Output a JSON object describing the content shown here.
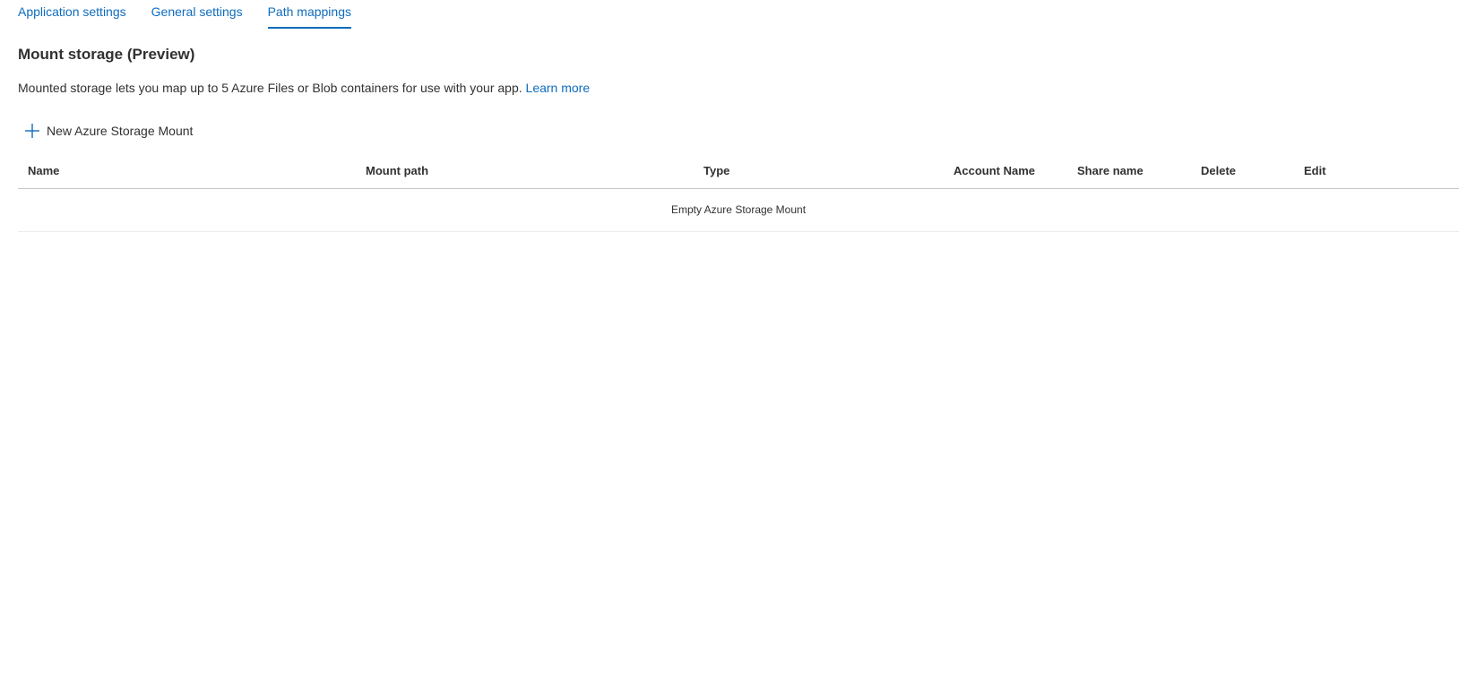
{
  "tabs": [
    {
      "label": "Application settings",
      "active": false
    },
    {
      "label": "General settings",
      "active": false
    },
    {
      "label": "Path mappings",
      "active": true
    }
  ],
  "section": {
    "title": "Mount storage (Preview)",
    "description": "Mounted storage lets you map up to 5 Azure Files or Blob containers for use with your app.",
    "learn_more": "Learn more"
  },
  "toolbar": {
    "add_label": "New Azure Storage Mount",
    "add_icon": "plus-icon"
  },
  "table": {
    "columns": [
      "Name",
      "Mount path",
      "Type",
      "Account Name",
      "Share name",
      "Delete",
      "Edit"
    ],
    "rows": [],
    "empty_message": "Empty Azure Storage Mount"
  },
  "colors": {
    "accent": "#0f6cbd",
    "text": "#323130",
    "divider": "#c8c6c4"
  }
}
